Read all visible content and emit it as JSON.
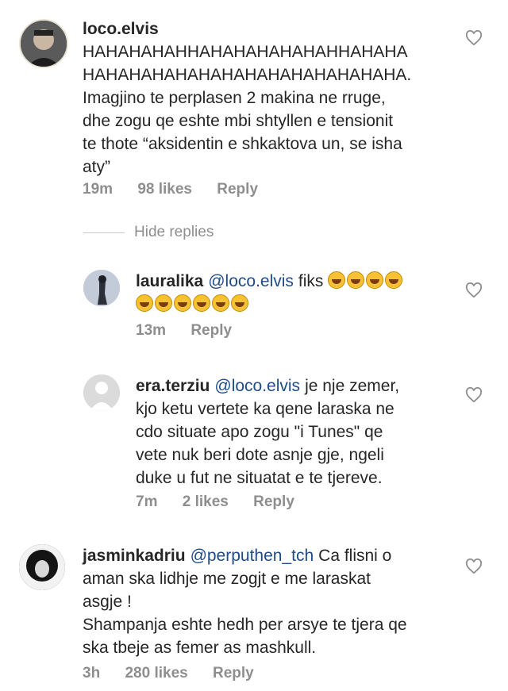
{
  "comments": [
    {
      "username": "loco.elvis",
      "text_lines": [
        "HAHAHAHAHHAHAHAHAHAHAHHAHAHA",
        "HAHAHAHAHAHAHAHAHAHAHAHAHAHA.",
        "Imagjino te perplasen 2 makina ne rruge,",
        "dhe zogu qe eshte mbi shtyllen e tensionit",
        "te thote “aksidentin e shkaktova un, se isha",
        "aty”"
      ],
      "time": "19m",
      "likes": "98 likes",
      "reply": "Reply"
    }
  ],
  "hide_replies": "Hide replies",
  "replies": [
    {
      "username": "lauralika",
      "mention": "@loco.elvis",
      "text_line1": "fiks",
      "emoji_count_line1": 4,
      "emoji_count_line2": 6,
      "time": "13m",
      "reply": "Reply"
    },
    {
      "username": "era.terziu",
      "mention": "@loco.elvis",
      "text_line1": "je nje zemer,",
      "text_lines": [
        "kjo ketu vertete ka qene laraska ne",
        "cdo situate apo zogu \"i Tunes\" qe",
        "vete nuk beri dote asnje gje, ngeli",
        "duke u fut ne situatat e te tjereve."
      ],
      "time": "7m",
      "likes": "2 likes",
      "reply": "Reply"
    }
  ],
  "comment2": {
    "username": "jasminkadriu",
    "mention": "@perputhen_tch",
    "text_line1": "Ca flisni o",
    "text_lines": [
      "aman ska  lidhje me zogjt e me laraskat",
      "asgje !",
      "Shampanja eshte hedh per arsye te tjera qe",
      "ska tbeje as femer as mashkull."
    ],
    "time": "3h",
    "likes": "280 likes",
    "reply": "Reply"
  },
  "icons": {
    "like": "heart-outline-icon",
    "emoji": "grinning-squinting-face-emoji"
  }
}
